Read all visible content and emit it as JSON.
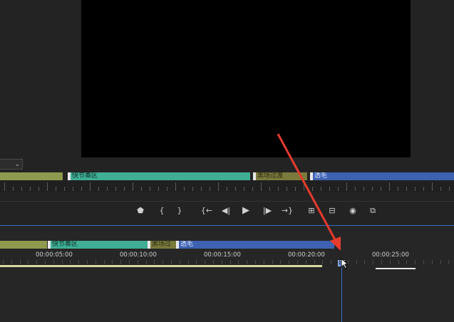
{
  "markers_upper": [
    {
      "label": "",
      "color": "#8f9a4e"
    },
    {
      "label": "快节奏区",
      "color": "#3fae95"
    },
    {
      "label": "黑场过渡",
      "color": "#7a7a3c"
    },
    {
      "label": "透毛",
      "color": "#3e62b1"
    }
  ],
  "markers_lower": [
    {
      "label": "",
      "color": "#8f9a4e"
    },
    {
      "label": "快节奏区",
      "color": "#3fae95"
    },
    {
      "label": "黑场过",
      "color": "#7a7a3c"
    },
    {
      "label": "透毛",
      "color": "#3e62b1"
    }
  ],
  "transport": {
    "buttons": [
      "marker",
      "mark-in",
      "mark-out",
      "go-to-in",
      "step-back",
      "play",
      "step-forward",
      "go-to-out",
      "lift",
      "extract",
      "export-frame",
      "button-editor"
    ]
  },
  "timecodes": [
    "00:00:05:00",
    "00:00:10:00",
    "00:00:15:00",
    "00:00:20:00",
    "00:00:25:00"
  ],
  "colors": {
    "accent": "#3a6ec8",
    "annotation_arrow": "#e63a2e"
  }
}
